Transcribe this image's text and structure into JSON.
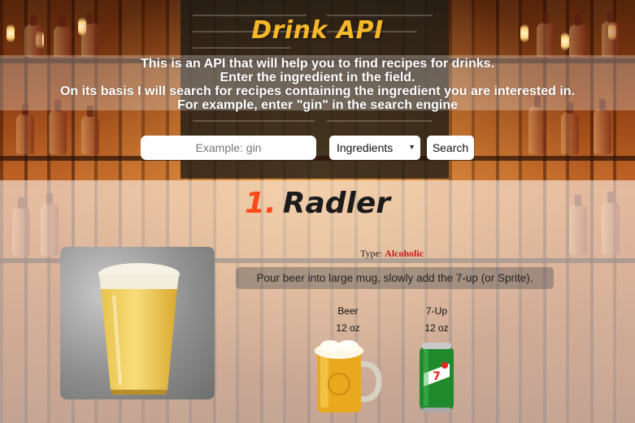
{
  "header": {
    "title": "Drink API"
  },
  "intro": {
    "lines": [
      "This is an API that will help you to find recipes for drinks.",
      "Enter the ingredient in the field.",
      "On its basis I will search for recipes containing the ingredient you are interested in.",
      "For example, enter \"gin\" in the search engine"
    ]
  },
  "search": {
    "placeholder": "Example: gin",
    "value": "",
    "select_value": "Ingredients",
    "button_label": "Search"
  },
  "result": {
    "number": "1.",
    "name": "Radler",
    "type_label": "Type:",
    "type_value": "Alcoholic",
    "instructions": "Pour beer into large mug, slowly add the 7-up (or Sprite).",
    "ingredients": [
      {
        "name": "Beer",
        "amount": "12 oz",
        "icon": "beer-mug-icon"
      },
      {
        "name": "7-Up",
        "amount": "12 oz",
        "icon": "soda-can-icon"
      }
    ]
  },
  "colors": {
    "title": "#f6b82a",
    "number_accent": "#ff4a1a",
    "type_value": "#c41a1a"
  }
}
